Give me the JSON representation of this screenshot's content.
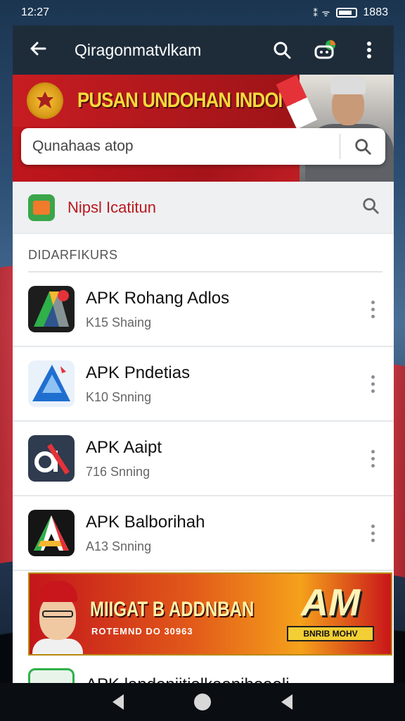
{
  "status_bar": {
    "time": "12:27",
    "signal": "⁑ ᯤ",
    "battery_text": "1883"
  },
  "toolbar": {
    "title": "Qiragonmatvlkam"
  },
  "hero": {
    "title": "PUSAN UNDOHAN INDONESIA",
    "search": {
      "placeholder": "Qunahaas atop"
    }
  },
  "app_header": {
    "name": "Nipsl Icatitun"
  },
  "section": {
    "label": "DIDARFIKURS"
  },
  "items": [
    {
      "title": "APK Rohang Adlos",
      "subtitle": "K15 Shaing"
    },
    {
      "title": "APK Pndetias",
      "subtitle": "K10 Snning"
    },
    {
      "title": "APK Aaipt",
      "subtitle": "716 Snning"
    },
    {
      "title": "APK Balborihah",
      "subtitle": "A13 Snning"
    }
  ],
  "promo": {
    "title": "MIIGAT B  ADDNBAN",
    "subtitle": "ROTEMND DO 30963",
    "brand": "AM",
    "brand_tag": "BNRIB MOHV"
  },
  "partial_item": {
    "title": "APK landeniitiolkaanihoaeli"
  },
  "colors": {
    "toolbar": "#1e2c3a",
    "accent_red": "#b9181e",
    "hero_yellow": "#f7d93d"
  }
}
